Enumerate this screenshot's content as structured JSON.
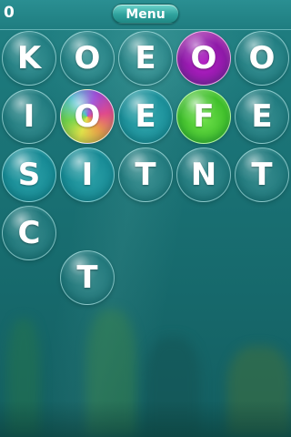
{
  "header": {
    "score": "0",
    "menu_label": "Menu"
  },
  "board": {
    "bubbles": [
      {
        "letter": "K",
        "style": "plain"
      },
      {
        "letter": "O",
        "style": "plain"
      },
      {
        "letter": "E",
        "style": "plain"
      },
      {
        "letter": "O",
        "style": "magenta"
      },
      {
        "letter": "O",
        "style": "plain"
      },
      {
        "letter": "I",
        "style": "plain"
      },
      {
        "letter": "O",
        "style": "rainbow"
      },
      {
        "letter": "E",
        "style": "cyan"
      },
      {
        "letter": "F",
        "style": "green"
      },
      {
        "letter": "E",
        "style": "plain"
      },
      {
        "letter": "S",
        "style": "cyan"
      },
      {
        "letter": "I",
        "style": "cyan"
      },
      {
        "letter": "T",
        "style": "plain"
      },
      {
        "letter": "N",
        "style": "plain"
      },
      {
        "letter": "T",
        "style": "plain"
      },
      {
        "letter": "C",
        "style": "plain"
      },
      {
        "letter": "T",
        "style": "plain"
      }
    ]
  },
  "colors": {
    "background": "#1b7477",
    "bubble_green": "#3fbf2b",
    "bubble_magenta": "#8e1aa8",
    "bubble_cyan": "#20a0b0"
  }
}
